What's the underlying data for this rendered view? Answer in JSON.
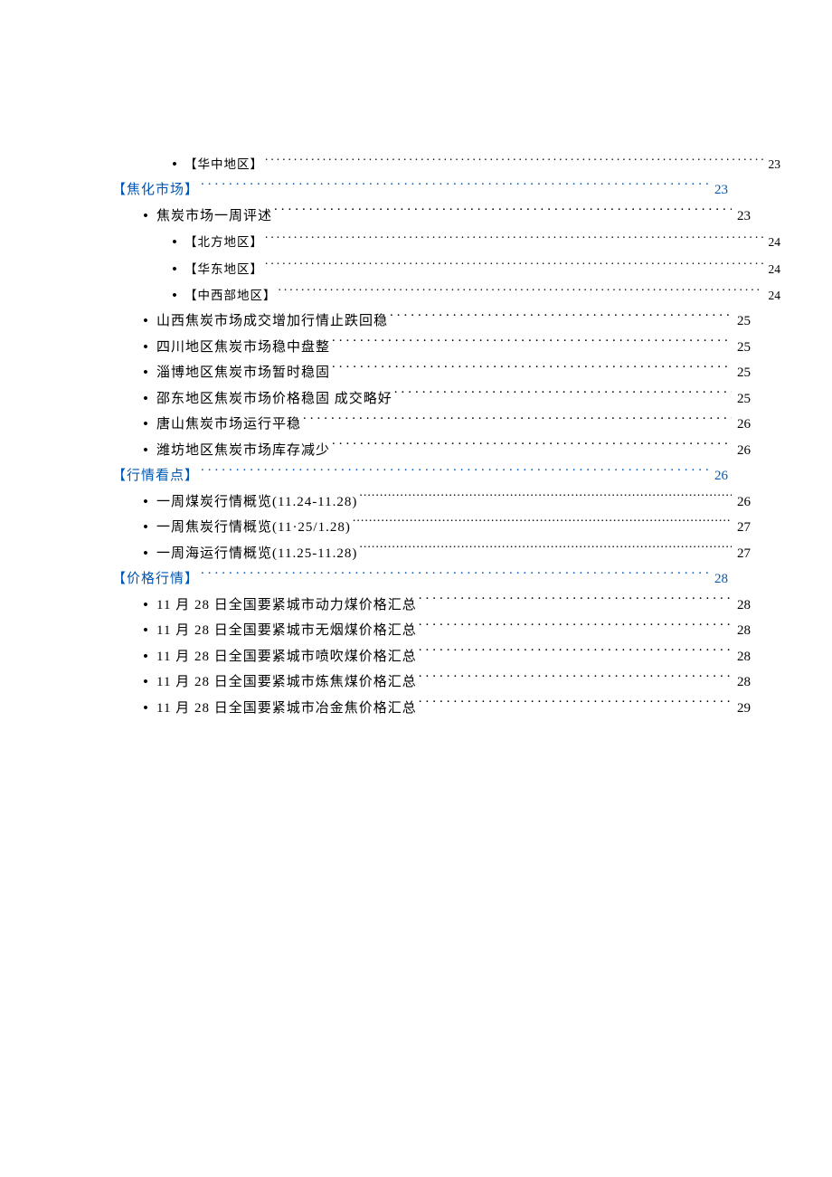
{
  "toc": [
    {
      "level": 2,
      "bullet": "•",
      "label": "【华中地区】",
      "page": "23",
      "kind": "sub"
    },
    {
      "level": 0,
      "bullet": "",
      "label": "【焦化市场】",
      "page": "23",
      "kind": "section"
    },
    {
      "level": 1,
      "bullet": "•",
      "label": "焦炭市场一周评述",
      "page": "23",
      "kind": "item"
    },
    {
      "level": 2,
      "bullet": "•",
      "label": "【北方地区】",
      "page": "24",
      "kind": "sub"
    },
    {
      "level": 2,
      "bullet": "•",
      "label": "【华东地区】",
      "page": "24",
      "kind": "sub"
    },
    {
      "level": 2,
      "bullet": "•",
      "label": "【中西部地区】",
      "page": "24",
      "kind": "sub"
    },
    {
      "level": 1,
      "bullet": "•",
      "label": "山西焦炭市场成交增加行情止跌回稳",
      "page": "25",
      "kind": "item"
    },
    {
      "level": 1,
      "bullet": "•",
      "label": "四川地区焦炭市场稳中盘整",
      "page": "25",
      "kind": "item"
    },
    {
      "level": 1,
      "bullet": "•",
      "label": "淄博地区焦炭市场暂时稳固",
      "page": "25",
      "kind": "item"
    },
    {
      "level": 1,
      "bullet": "•",
      "label": "邵东地区焦炭市场价格稳固 成交略好",
      "page": "25",
      "kind": "item"
    },
    {
      "level": 1,
      "bullet": "•",
      "label": "唐山焦炭市场运行平稳",
      "page": "26",
      "kind": "item"
    },
    {
      "level": 1,
      "bullet": "•",
      "label": "潍坊地区焦炭市场库存减少",
      "page": "26",
      "kind": "item"
    },
    {
      "level": 0,
      "bullet": "",
      "label": "【行情看点】",
      "page": "26",
      "kind": "section"
    },
    {
      "level": 1,
      "bullet": "•",
      "label": "一周煤炭行情概览(11.24-11.28)",
      "page": "26",
      "kind": "overview"
    },
    {
      "level": 1,
      "bullet": "•",
      "label": "一周焦炭行情概览(11·25/1.28)",
      "page": "27",
      "kind": "overview"
    },
    {
      "level": 1,
      "bullet": "•",
      "label": "一周海运行情概览(11.25-11.28)",
      "page": "27",
      "kind": "overview"
    },
    {
      "level": 0,
      "bullet": "",
      "label": "【价格行情】",
      "page": "28",
      "kind": "section"
    },
    {
      "level": 1,
      "bullet": "•",
      "label": "11 月 28 日全国要紧城市动力煤价格汇总",
      "page": "28",
      "kind": "item"
    },
    {
      "level": 1,
      "bullet": "•",
      "label": "11 月 28 日全国要紧城市无烟煤价格汇总",
      "page": "28",
      "kind": "item"
    },
    {
      "level": 1,
      "bullet": "•",
      "label": "11 月 28 日全国要紧城市喷吹煤价格汇总",
      "page": "28",
      "kind": "item"
    },
    {
      "level": 1,
      "bullet": "•",
      "label": "11 月 28 日全国要紧城市炼焦煤价格汇总",
      "page": "28",
      "kind": "item"
    },
    {
      "level": 1,
      "bullet": "•",
      "label": "11 月 28 日全国要紧城市冶金焦价格汇总",
      "page": "29",
      "kind": "item"
    }
  ]
}
